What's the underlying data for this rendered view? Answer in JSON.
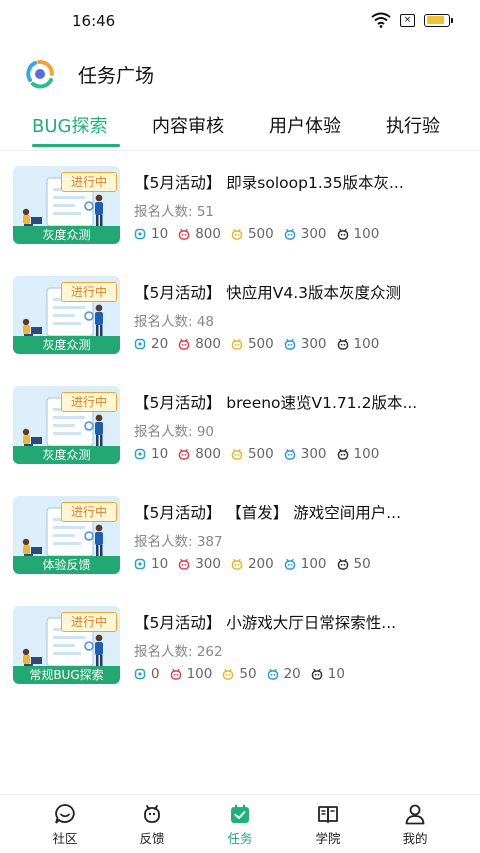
{
  "status_bar": {
    "time": "16:46",
    "battery_level": 0.85
  },
  "header": {
    "title": "任务广场"
  },
  "tabs": [
    {
      "label": "BUG探索",
      "active": true
    },
    {
      "label": "内容审核",
      "active": false
    },
    {
      "label": "用户体验",
      "active": false
    },
    {
      "label": "执行验",
      "active": false
    }
  ],
  "colors": {
    "accent": "#20b07a",
    "reward_icons": [
      "#29a3c9",
      "#d9424f",
      "#e8b52e",
      "#2b9bd6",
      "#333333"
    ]
  },
  "tasks": [
    {
      "badge": "进行中",
      "thumb_label": "灰度众测",
      "title": "【5月活动】 即录soloop1.35版本灰...",
      "signup": "报名人数: 51",
      "rewards": [
        "10",
        "800",
        "500",
        "300",
        "100"
      ]
    },
    {
      "badge": "进行中",
      "thumb_label": "灰度众测",
      "title": "【5月活动】 快应用V4.3版本灰度众测",
      "signup": "报名人数: 48",
      "rewards": [
        "20",
        "800",
        "500",
        "300",
        "100"
      ]
    },
    {
      "badge": "进行中",
      "thumb_label": "灰度众测",
      "title": "【5月活动】 breeno速览V1.71.2版本...",
      "signup": "报名人数: 90",
      "rewards": [
        "10",
        "800",
        "500",
        "300",
        "100"
      ]
    },
    {
      "badge": "进行中",
      "thumb_label": "体验反馈",
      "title": "【5月活动】 【首发】 游戏空间用户...",
      "signup": "报名人数: 387",
      "rewards": [
        "10",
        "300",
        "200",
        "100",
        "50"
      ]
    },
    {
      "badge": "进行中",
      "thumb_label": "常规BUG探索",
      "title": "【5月活动】 小游戏大厅日常探索性...",
      "signup": "报名人数: 262",
      "rewards": [
        "0",
        "100",
        "50",
        "20",
        "10"
      ]
    }
  ],
  "bottom_nav": [
    {
      "label": "社区",
      "icon": "chat-smile-icon",
      "active": false
    },
    {
      "label": "反馈",
      "icon": "bug-icon",
      "active": false
    },
    {
      "label": "任务",
      "icon": "task-calendar-icon",
      "active": true
    },
    {
      "label": "学院",
      "icon": "book-icon",
      "active": false
    },
    {
      "label": "我的",
      "icon": "user-icon",
      "active": false
    }
  ]
}
